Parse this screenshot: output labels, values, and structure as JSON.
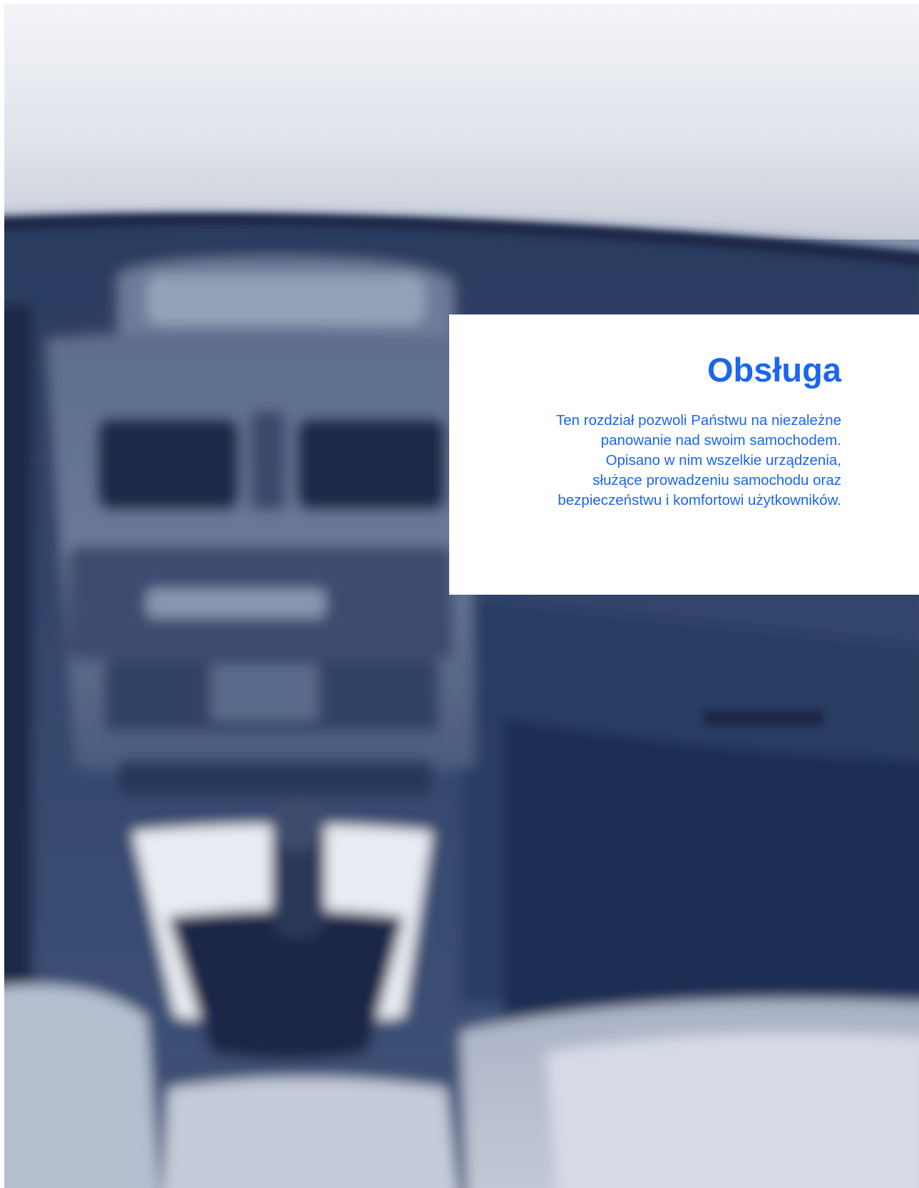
{
  "section": {
    "title": "Obsługa",
    "intro_lines": [
      "Ten rozdział pozwoli Państwu na niezależne",
      "panowanie nad swoim samochodem.",
      "Opisano w nim wszelkie urządzenia,",
      "służące prowadzeniu samochodu oraz",
      "bezpieczeństwu i komfortowi użytkowników."
    ]
  },
  "colors": {
    "accent": "#1a66f0",
    "photo_tint": "#2a3a5e"
  },
  "photo": {
    "subject": "car-interior-dashboard-photo"
  }
}
